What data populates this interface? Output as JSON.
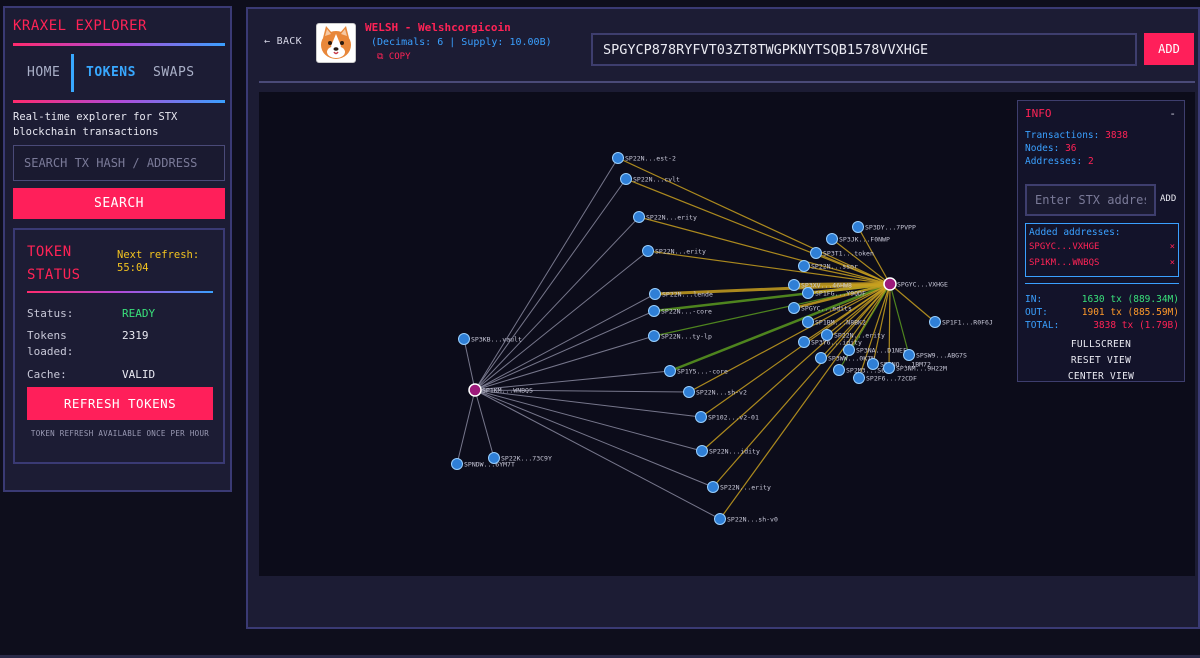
{
  "app": {
    "brand": "KRAXEL EXPLORER"
  },
  "nav": {
    "home": "HOME",
    "tokens": "TOKENS",
    "swaps": "SWAPS"
  },
  "sidebar": {
    "description": "Real-time explorer for STX blockchain transactions",
    "search_placeholder": "SEARCH TX HASH / ADDRESS",
    "search_button": "SEARCH"
  },
  "token_status": {
    "title": "TOKEN STATUS",
    "next_refresh_label": "Next refresh:",
    "next_refresh_value": "55:04",
    "rows": [
      {
        "label": "Status:",
        "value": "READY",
        "color": "#39e07a"
      },
      {
        "label": "Tokens loaded:",
        "value": "2319",
        "color": "#eaeaf2"
      },
      {
        "label": "Cache:",
        "value": "VALID",
        "color": "#eaeaf2"
      }
    ],
    "refresh_button": "REFRESH TOKENS",
    "refresh_note": "TOKEN REFRESH AVAILABLE ONCE PER HOUR"
  },
  "header": {
    "back": "← BACK",
    "token_name": "WELSH - Welshcorgicoin",
    "token_meta": "(Decimals: 6 | Supply: 10.00B)",
    "copy": "⧉ COPY",
    "address_value": "SPGYCP878RYFVT03ZT8TWGPKNYTSQB1578VVXHGE",
    "add_button": "ADD"
  },
  "info": {
    "title": "INFO",
    "collapse": "-",
    "transactions_label": "Transactions:",
    "transactions_value": "3838",
    "nodes_label": "Nodes:",
    "nodes_value": "36",
    "addresses_label": "Addresses:",
    "addresses_value": "2",
    "input_placeholder": "Enter STX address",
    "add_button": "ADD",
    "added_title": "Added addresses:",
    "added": [
      {
        "address": "SPGYC...VXHGE",
        "remove": "×"
      },
      {
        "address": "SP1KM...WNBQS",
        "remove": "×"
      }
    ],
    "flows": [
      {
        "label": "IN:",
        "value": "1630 tx (889.34M)",
        "color": "#39e07a"
      },
      {
        "label": "OUT:",
        "value": "1901 tx (885.59M)",
        "color": "#ff9a2a"
      },
      {
        "label": "TOTAL:",
        "value": "3838 tx (1.79B)",
        "color": "#ff2356"
      }
    ],
    "actions": {
      "fullscreen": "FULLSCREEN",
      "reset": "RESET VIEW",
      "center": "CENTER VIEW"
    }
  },
  "graph": {
    "colors": {
      "node": "#2f7fd6",
      "node_stroke": "#9ad0ff",
      "hub": "#9c1a7a",
      "grey_edge": "#8a8aa0",
      "gold_edge": "#c8a020",
      "green_edge": "#5a9a20"
    },
    "hubs": [
      {
        "id": "A",
        "label": "SPGYC...VXHGE"
      },
      {
        "id": "B",
        "label": "SP1KM...WNBQS"
      }
    ],
    "nodes": [
      {
        "id": "n1",
        "label": "SP22N...est-2"
      },
      {
        "id": "n2",
        "label": "SP22N...cvlt"
      },
      {
        "id": "n3",
        "label": "SP22N...erity"
      },
      {
        "id": "n4",
        "label": "SP22N...erity"
      },
      {
        "id": "n5",
        "label": "SP22N...lende"
      },
      {
        "id": "n6",
        "label": "SP22N...-core"
      },
      {
        "id": "n7",
        "label": "SP22N...ty-lp"
      },
      {
        "id": "n8",
        "label": "SP1Y5...-core"
      },
      {
        "id": "n9",
        "label": "SP22N...sh-v2"
      },
      {
        "id": "n10",
        "label": "SP102...v2-01"
      },
      {
        "id": "n11",
        "label": "SP22N...idity"
      },
      {
        "id": "n12",
        "label": "SP22N...erity"
      },
      {
        "id": "n13",
        "label": "SP22N...sh-v0"
      },
      {
        "id": "n14",
        "label": "SP3KB...vault"
      },
      {
        "id": "n15",
        "label": "SPNDW...6YM7T"
      },
      {
        "id": "n16",
        "label": "SP22K...73C9Y"
      },
      {
        "id": "n17",
        "label": "SP3DY...7PVPP"
      },
      {
        "id": "n18",
        "label": "SP3JK...F0NWP"
      },
      {
        "id": "n19",
        "label": "SP3T1...token"
      },
      {
        "id": "n20",
        "label": "SP22N...ssor"
      },
      {
        "id": "n21",
        "label": "SP3XV...46HW8"
      },
      {
        "id": "n22",
        "label": "SP1FG...Y9QDF"
      },
      {
        "id": "n23",
        "label": "SPGYC...edits"
      },
      {
        "id": "n24",
        "label": "SP1BM...N8BK2"
      },
      {
        "id": "n25",
        "label": "SP22N...erity"
      },
      {
        "id": "n26",
        "label": "SP3Y6...idity"
      },
      {
        "id": "n27",
        "label": "SP3WW...0K7N"
      },
      {
        "id": "n28",
        "label": "SP3NA...D1NEF"
      },
      {
        "id": "n29",
        "label": "SP2M3...S60W"
      },
      {
        "id": "n30",
        "label": "SP3NQ...1BM72"
      },
      {
        "id": "n31",
        "label": "SP2F6...72CDF"
      },
      {
        "id": "n32",
        "label": "SPSW9...ABG7S"
      },
      {
        "id": "n33",
        "label": "SP1F1...R0F6J"
      },
      {
        "id": "n34",
        "label": "SP3NM...9H22M"
      }
    ]
  }
}
